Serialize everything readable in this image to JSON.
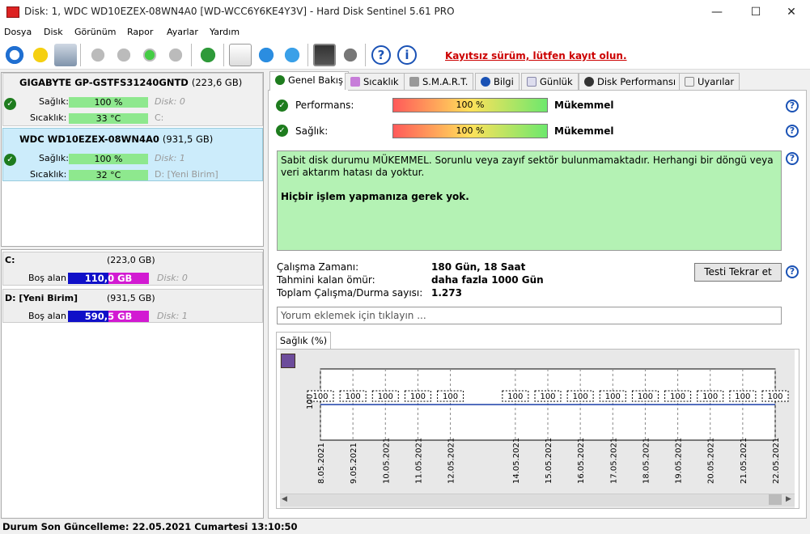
{
  "window": {
    "title": "Disk: 1, WDC WD10EZEX-08WN4A0 [WD-WCC6Y6KE4Y3V]  -  Hard Disk Sentinel 5.61 PRO",
    "minimize": "—",
    "maximize": "☐",
    "close": "✕"
  },
  "menu": [
    {
      "label": "Dosya"
    },
    {
      "label": "Disk"
    },
    {
      "label": "Görünüm"
    },
    {
      "label": "Rapor"
    },
    {
      "label": "Ayarlar"
    },
    {
      "label": "Yardım"
    }
  ],
  "toolbar": {
    "register_link": "Kayıtsız sürüm, lütfen kayıt olun.",
    "icons": [
      "refresh-icon",
      "alert-icon",
      "disk-icon",
      "hdd-icon",
      "hdd-icon",
      "hdd-ok-icon",
      "hdd-search-icon",
      "globe-icon",
      "report-icon",
      "update-icon",
      "network-icon",
      "monitor-icon",
      "speaker-icon",
      "help-icon",
      "info-icon"
    ]
  },
  "disks": [
    {
      "name": "GIGABYTE GP-GSTFS31240GNTD",
      "size": "(223,6 GB)",
      "health_label": "Sağlık:",
      "health": "100 %",
      "health_pct": 100,
      "disk_label": "Disk: 0",
      "temp_label": "Sıcaklık:",
      "temp": "33 °C",
      "volume": "C:"
    },
    {
      "name": "WDC WD10EZEX-08WN4A0",
      "size": "(931,5 GB)",
      "health_label": "Sağlık:",
      "health": "100 %",
      "health_pct": 100,
      "disk_label": "Disk: 1",
      "temp_label": "Sıcaklık:",
      "temp": "32 °C",
      "volume": "D: [Yeni Birim]"
    }
  ],
  "volumes": [
    {
      "name": "C:",
      "size": "(223,0 GB)",
      "free_label": "Boş alan",
      "free": "110,0 GB",
      "disk_label": "Disk: 0"
    },
    {
      "name": "D: [Yeni Birim]",
      "size": "(931,5 GB)",
      "free_label": "Boş alan",
      "free": "590,5 GB",
      "disk_label": "Disk: 1"
    }
  ],
  "tabs": [
    {
      "label": "Genel Bakış",
      "active": true
    },
    {
      "label": "Sıcaklık"
    },
    {
      "label": "S.M.A.R.T."
    },
    {
      "label": "Bilgi"
    },
    {
      "label": "Günlük"
    },
    {
      "label": "Disk Performansı"
    },
    {
      "label": "Uyarılar"
    }
  ],
  "overview": {
    "performance_label": "Performans:",
    "performance_value": "100 %",
    "performance_pct": 100,
    "performance_text": "Mükemmel",
    "health_label": "Sağlık:",
    "health_value": "100 %",
    "health_pct": 100,
    "health_text": "Mükemmel",
    "status_line1": "Sabit disk durumu MÜKEMMEL. Sorunlu veya zayıf sektör bulunmamaktadır. Herhangi bir döngü veya veri aktarım hatası da yoktur.",
    "status_line2": "Hiçbir işlem yapmanıza gerek yok.",
    "uptime_label": "Çalışma Zamanı:",
    "uptime": "180 Gün, 18 Saat",
    "remaining_label": "Tahmini kalan ömür:",
    "remaining": "daha fazla 1000 Gün",
    "startstop_label": "Toplam Çalışma/Durma sayısı:",
    "startstop": "1.273",
    "retest_button": "Testi Tekrar et",
    "comment_placeholder": "Yorum eklemek için tıklayın ..."
  },
  "chart_tab": "Sağlık (%)",
  "chart_data": {
    "type": "line",
    "title": "",
    "ylabel": "",
    "series": [
      {
        "values": [
          100,
          100,
          100,
          100,
          100,
          100,
          100,
          100,
          100,
          100,
          100,
          100,
          100,
          100
        ]
      }
    ],
    "x": [
      "8.05.2021",
      "9.05.2021",
      "10.05.2021",
      "11.05.2021",
      "12.05.2021",
      "14.05.2021",
      "15.05.2021",
      "16.05.2021",
      "17.05.2021",
      "18.05.2021",
      "19.05.2021",
      "20.05.2021",
      "21.05.2021",
      "22.05.2021"
    ],
    "y_tick": "100",
    "ylim": [
      100,
      100
    ],
    "grid": true
  },
  "statusbar": "Durum Son Güncelleme: 22.05.2021 Cumartesi 13:10:50"
}
